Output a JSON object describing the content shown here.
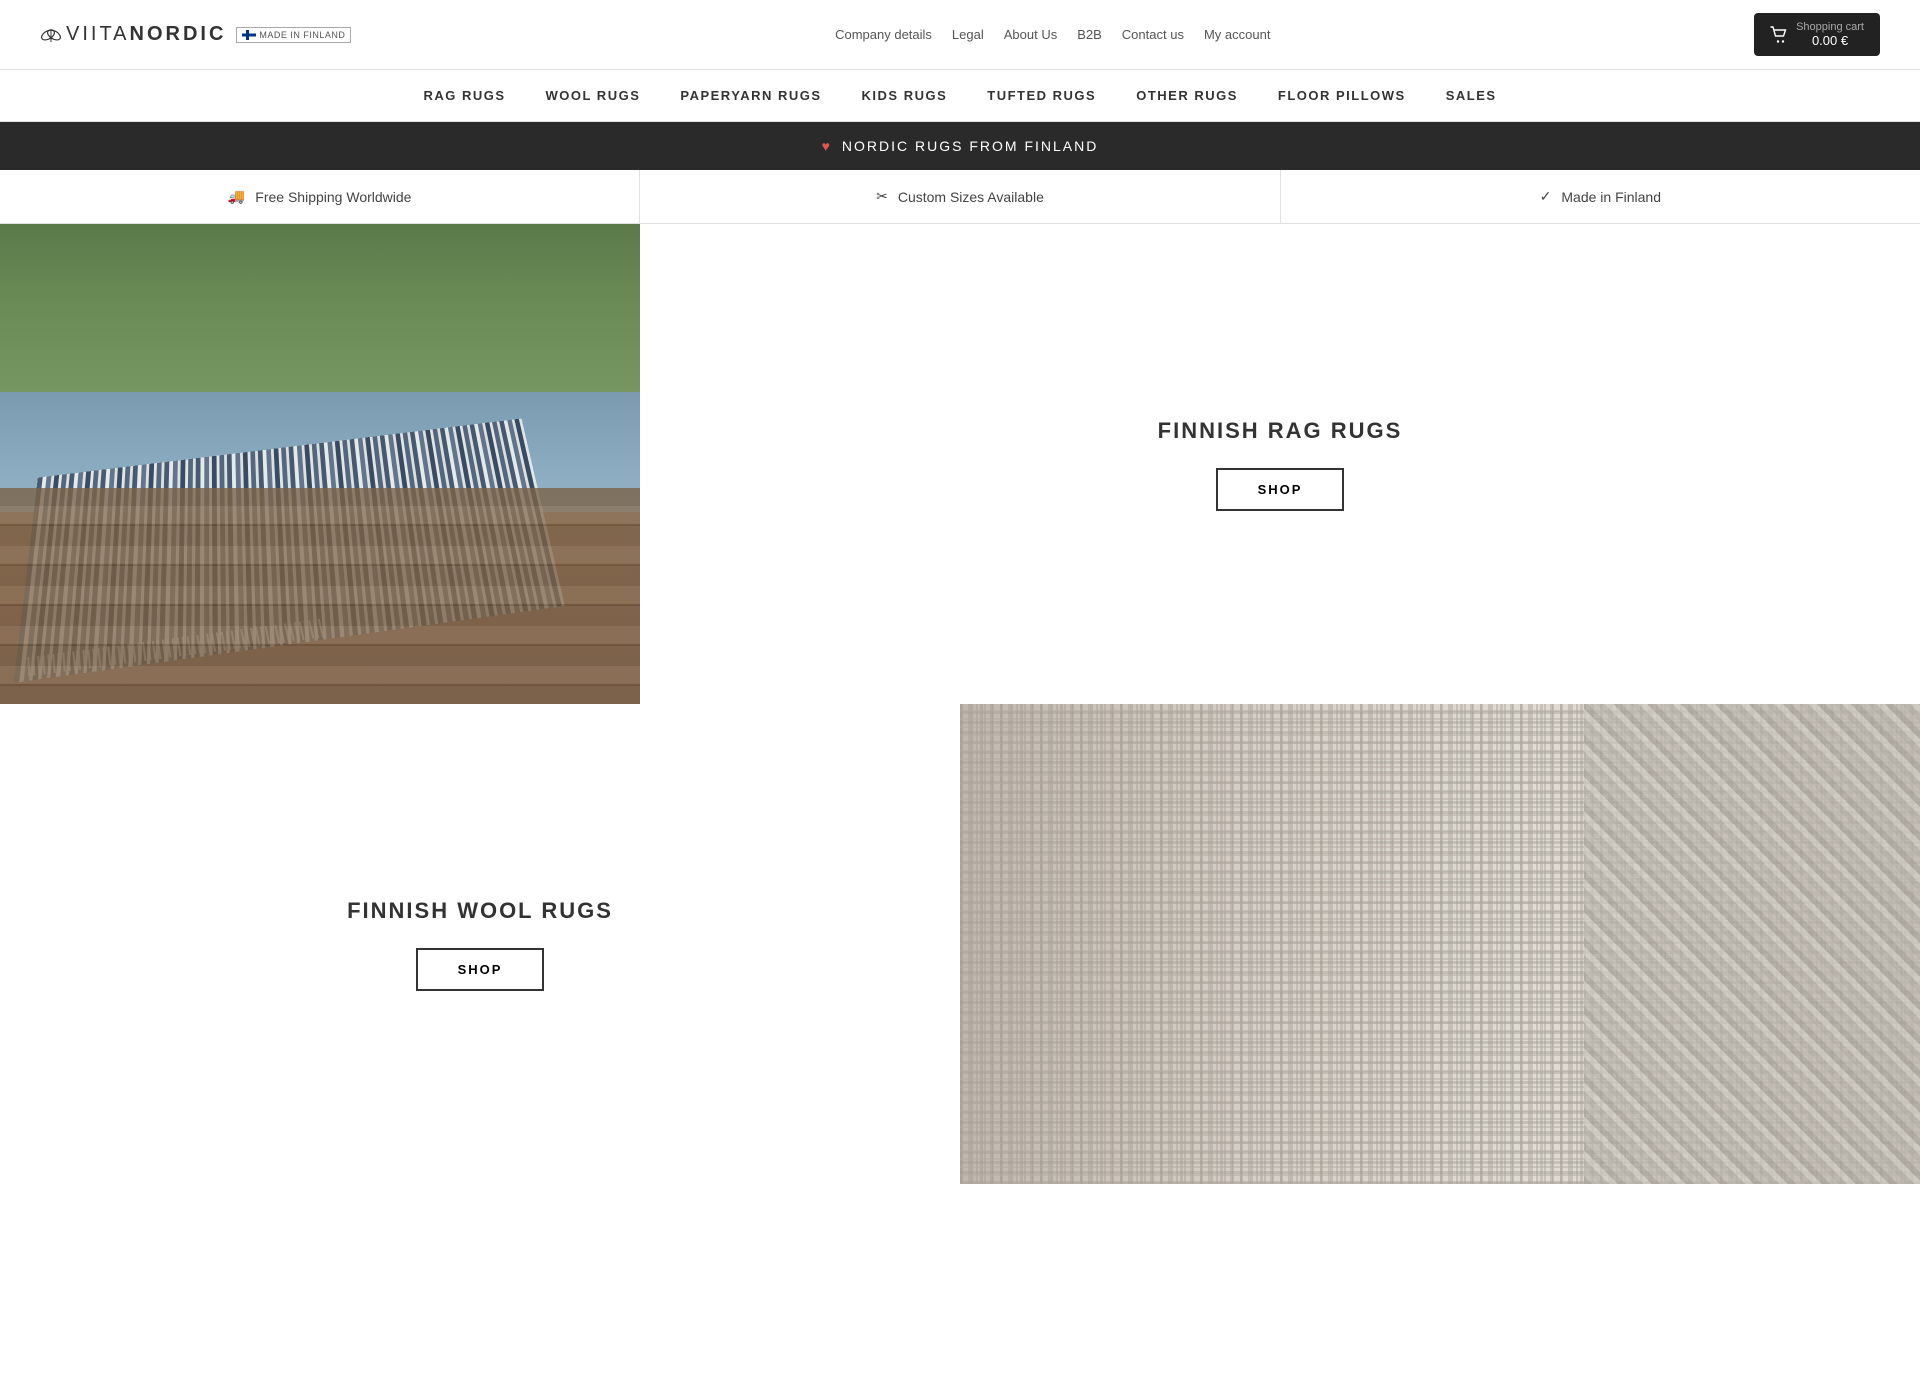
{
  "header": {
    "logo_text_light": "VIITA",
    "logo_text_bold": "NORDIC",
    "top_links": [
      {
        "label": "Company details",
        "name": "company-details-link"
      },
      {
        "label": "Legal",
        "name": "legal-link"
      },
      {
        "label": "About Us",
        "name": "about-us-link"
      },
      {
        "label": "B2B",
        "name": "b2b-link"
      },
      {
        "label": "Contact us",
        "name": "contact-us-link"
      },
      {
        "label": "My account",
        "name": "my-account-link"
      }
    ],
    "cart_label": "Shopping cart",
    "cart_amount": "0.00 €"
  },
  "nav": {
    "items": [
      {
        "label": "RAG RUGS",
        "name": "nav-rag-rugs"
      },
      {
        "label": "WOOL RUGS",
        "name": "nav-wool-rugs"
      },
      {
        "label": "PAPERYARN RUGS",
        "name": "nav-paperyarn-rugs"
      },
      {
        "label": "KIDS RUGS",
        "name": "nav-kids-rugs"
      },
      {
        "label": "TUFTED RUGS",
        "name": "nav-tufted-rugs"
      },
      {
        "label": "OTHER RUGS",
        "name": "nav-other-rugs"
      },
      {
        "label": "FLOOR PILLOWS",
        "name": "nav-floor-pillows"
      },
      {
        "label": "SALES",
        "name": "nav-sales"
      }
    ]
  },
  "banner": {
    "icon": "♥",
    "text": "NORDIC RUGS FROM FINLAND"
  },
  "features": [
    {
      "icon": "🚚",
      "text": "Free Shipping Worldwide"
    },
    {
      "icon": "✂",
      "text": "Custom Sizes Available"
    },
    {
      "icon": "✓",
      "text": "Made in Finland"
    }
  ],
  "sections": [
    {
      "title": "FINNISH RAG RUGS",
      "shop_label": "SHOP",
      "position": "right"
    },
    {
      "title": "FINNISH WOOL RUGS",
      "shop_label": "SHOP",
      "position": "left"
    }
  ]
}
